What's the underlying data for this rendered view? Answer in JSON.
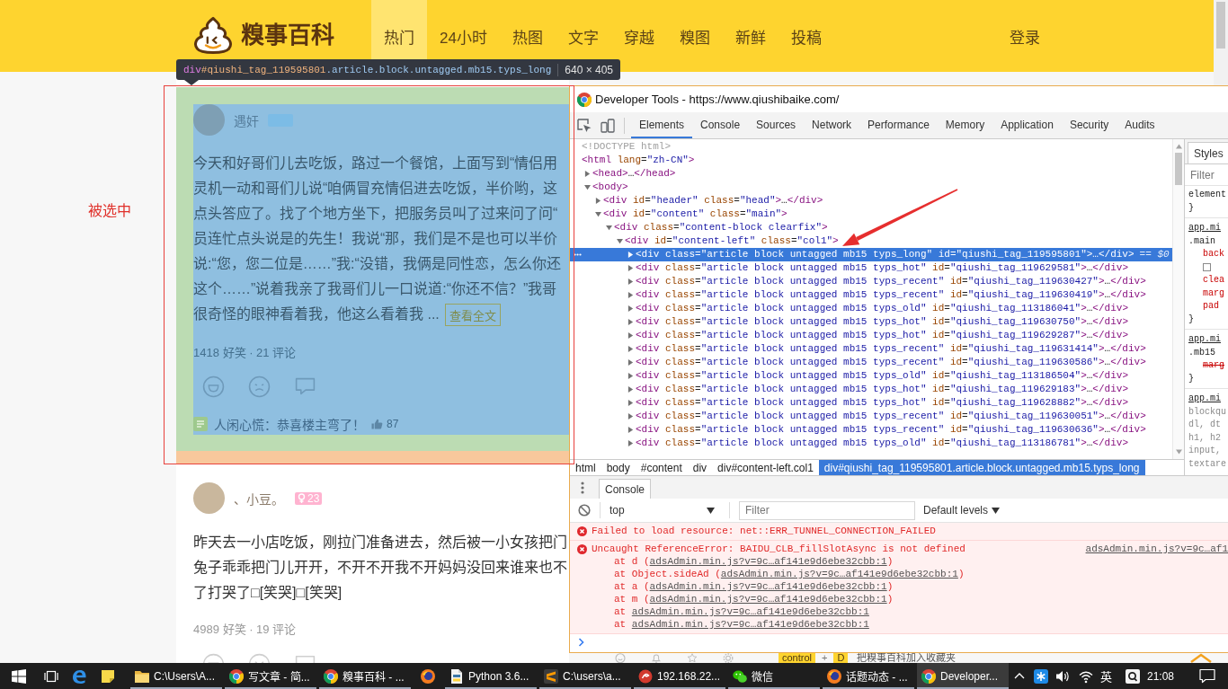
{
  "browser_page": {
    "header": {
      "logo_text": "糗事百科",
      "nav": [
        {
          "label": "热门",
          "selected": true
        },
        {
          "label": "24小时",
          "selected": false
        },
        {
          "label": "热图",
          "selected": false
        },
        {
          "label": "文字",
          "selected": false
        },
        {
          "label": "穿越",
          "selected": false
        },
        {
          "label": "糗图",
          "selected": false
        },
        {
          "label": "新鲜",
          "selected": false
        },
        {
          "label": "投稿",
          "selected": false
        }
      ],
      "login": "登录"
    },
    "inspect_tooltip": {
      "tag": "div",
      "id": "#qiushi_tag_119595801",
      "classes": ".article.block.untagged.mb15.typs_long",
      "size": "640 × 405"
    },
    "side_note": "被选中",
    "articles": [
      {
        "highlighted": true,
        "author": "遇奸",
        "badge": {
          "color": "#7cbce6"
        },
        "lines": [
          "今天和好哥们儿去吃饭，路过一个餐馆，上面写到“情侣用",
          "灵机一动和哥们儿说“咱俩冒充情侣进去吃饭，半价哟，这",
          "点头答应了。找了个地方坐下，把服务员叫了过来问了问“",
          "员连忙点头说是的先生！我说“那，我们是不是也可以半价",
          "说:“您，您二位是……”我:“没错，我俩是同性恋，怎么你还",
          "这个……”说着我亲了我哥们儿一口说道:“你还不信？”我哥",
          "很奇怪的眼神看着我，他这么看着我 ..."
        ],
        "more_link": "查看全文",
        "stats": "1418 好笑 · 21 评论",
        "top_comment": {
          "text": "人闲心慌：恭喜楼主弯了！",
          "likes": "87"
        }
      },
      {
        "highlighted": false,
        "author": "、小豆。",
        "badge": {
          "color": "#ffb3d0",
          "text": "23"
        },
        "lines": [
          "昨天去一小店吃饭，刚拉门准备进去，然后被一小女孩把门",
          "兔子乖乖把门儿开开，不开不开我不开妈妈没回来谁来也不",
          "了打哭了□[笑哭]□[笑哭]"
        ],
        "stats": "4989 好笑 · 19 评论"
      }
    ],
    "bookmark_hint": {
      "keys": [
        "control",
        "D"
      ],
      "joiner": "+",
      "text": "把糗事百科加入收藏夹"
    }
  },
  "devtools": {
    "title": "Developer Tools - https://www.qiushibaike.com/",
    "tabs": [
      {
        "label": "Elements",
        "selected": true
      },
      {
        "label": "Console",
        "selected": false
      },
      {
        "label": "Sources",
        "selected": false
      },
      {
        "label": "Network",
        "selected": false
      },
      {
        "label": "Performance",
        "selected": false
      },
      {
        "label": "Memory",
        "selected": false
      },
      {
        "label": "Application",
        "selected": false
      },
      {
        "label": "Security",
        "selected": false
      },
      {
        "label": "Audits",
        "selected": false
      }
    ],
    "dom_tree": [
      {
        "kind": "doctype",
        "markup": "<!DOCTYPE html>",
        "selected": false
      },
      {
        "kind": "root",
        "markup": "<html lang=\"zh-CN\">",
        "selected": false,
        "children": [
          {
            "kind": "element",
            "markup": "<head>…</head>",
            "expanded": false,
            "selected": false
          },
          {
            "kind": "element",
            "markup": "<body>",
            "expanded": true,
            "selected": false,
            "children": [
              {
                "kind": "element",
                "markup": "<div id=\"header\" class=\"head\">…</div>",
                "expanded": false,
                "selected": false
              },
              {
                "kind": "element",
                "markup": "<div id=\"content\" class=\"main\">",
                "expanded": true,
                "selected": false,
                "children": [
                  {
                    "kind": "element",
                    "markup": "<div class=\"content-block clearfix\">",
                    "expanded": true,
                    "selected": false,
                    "children": [
                      {
                        "kind": "element",
                        "markup": "<div id=\"content-left\" class=\"col1\">",
                        "expanded": true,
                        "selected": false,
                        "children": [
                          {
                            "kind": "element",
                            "markup": "<div class=\"article block untagged mb15 typs_long\" id=\"qiushi_tag_119595801\">…</div>",
                            "expanded": false,
                            "selected": true,
                            "console_ref": "== $0"
                          },
                          {
                            "kind": "element",
                            "markup": "<div class=\"article block untagged mb15 typs_hot\" id=\"qiushi_tag_119629581\">…</div>",
                            "expanded": false,
                            "selected": false
                          },
                          {
                            "kind": "element",
                            "markup": "<div class=\"article block untagged mb15 typs_recent\" id=\"qiushi_tag_119630427\">…</div>",
                            "expanded": false,
                            "selected": false
                          },
                          {
                            "kind": "element",
                            "markup": "<div class=\"article block untagged mb15 typs_recent\" id=\"qiushi_tag_119630419\">…</div>",
                            "expanded": false,
                            "selected": false
                          },
                          {
                            "kind": "element",
                            "markup": "<div class=\"article block untagged mb15 typs_old\" id=\"qiushi_tag_113186041\">…</div>",
                            "expanded": false,
                            "selected": false
                          },
                          {
                            "kind": "element",
                            "markup": "<div class=\"article block untagged mb15 typs_hot\" id=\"qiushi_tag_119630750\">…</div>",
                            "expanded": false,
                            "selected": false
                          },
                          {
                            "kind": "element",
                            "markup": "<div class=\"article block untagged mb15 typs_hot\" id=\"qiushi_tag_119629287\">…</div>",
                            "expanded": false,
                            "selected": false
                          },
                          {
                            "kind": "element",
                            "markup": "<div class=\"article block untagged mb15 typs_recent\" id=\"qiushi_tag_119631414\">…</div>",
                            "expanded": false,
                            "selected": false
                          },
                          {
                            "kind": "element",
                            "markup": "<div class=\"article block untagged mb15 typs_recent\" id=\"qiushi_tag_119630586\">…</div>",
                            "expanded": false,
                            "selected": false
                          },
                          {
                            "kind": "element",
                            "markup": "<div class=\"article block untagged mb15 typs_old\" id=\"qiushi_tag_113186504\">…</div>",
                            "expanded": false,
                            "selected": false
                          },
                          {
                            "kind": "element",
                            "markup": "<div class=\"article block untagged mb15 typs_hot\" id=\"qiushi_tag_119629183\">…</div>",
                            "expanded": false,
                            "selected": false
                          },
                          {
                            "kind": "element",
                            "markup": "<div class=\"article block untagged mb15 typs_hot\" id=\"qiushi_tag_119628882\">…</div>",
                            "expanded": false,
                            "selected": false
                          },
                          {
                            "kind": "element",
                            "markup": "<div class=\"article block untagged mb15 typs_recent\" id=\"qiushi_tag_119630051\">…</div>",
                            "expanded": false,
                            "selected": false
                          },
                          {
                            "kind": "element",
                            "markup": "<div class=\"article block untagged mb15 typs_recent\" id=\"qiushi_tag_119630636\">…</div>",
                            "expanded": false,
                            "selected": false
                          },
                          {
                            "kind": "element",
                            "markup": "<div class=\"article block untagged mb15 typs_old\" id=\"qiushi_tag_113186781\">…</div>",
                            "expanded": false,
                            "selected": false
                          }
                        ]
                      }
                    ]
                  }
                ]
              }
            ]
          }
        ]
      }
    ],
    "breadcrumbs": [
      {
        "label": "html",
        "selected": false
      },
      {
        "label": "body",
        "selected": false
      },
      {
        "label": "#content",
        "selected": false
      },
      {
        "label": "div",
        "selected": false
      },
      {
        "label": "div#content-left.col1",
        "selected": false
      },
      {
        "label": "div#qiushi_tag_119595801.article.block.untagged.mb15.typs_long",
        "selected": true
      }
    ],
    "styles": {
      "tab": "Styles",
      "filter_placeholder": "Filter",
      "lines": [
        {
          "kind": "selector",
          "text": "element"
        },
        {
          "kind": "brace",
          "text": "}"
        },
        {
          "kind": "source",
          "text": "app.mi"
        },
        {
          "kind": "selector",
          "text": ".main"
        },
        {
          "kind": "property",
          "text": "back",
          "struck": false
        },
        {
          "kind": "swatch"
        },
        {
          "kind": "property",
          "text": "clea",
          "struck": false
        },
        {
          "kind": "property",
          "text": "marg",
          "struck": false
        },
        {
          "kind": "property",
          "text": "pad",
          "struck": false
        },
        {
          "kind": "brace",
          "text": "}"
        },
        {
          "kind": "source",
          "text": "app.mi"
        },
        {
          "kind": "selector",
          "text": ".mb15"
        },
        {
          "kind": "property",
          "text": "marg",
          "struck": true
        },
        {
          "kind": "brace",
          "text": "}"
        },
        {
          "kind": "source",
          "text": "app.mi"
        },
        {
          "kind": "dim-selector",
          "text": "blockqu"
        },
        {
          "kind": "dim-selector",
          "text": "dl, dt"
        },
        {
          "kind": "dim-selector",
          "text": "h1, h2"
        },
        {
          "kind": "dim-selector",
          "text": "input,"
        },
        {
          "kind": "dim-selector",
          "text": "textare"
        }
      ]
    },
    "console": {
      "tab": "Console",
      "context": "top",
      "filter_placeholder": "Filter",
      "levels": "Default levels",
      "messages": [
        {
          "kind": "error",
          "text": "Failed to load resource: net::ERR_TUNNEL_CONNECTION_FAILED"
        },
        {
          "kind": "error",
          "text": "Uncaught ReferenceError: BAIDU_CLB_fillSlotAsync is not defined",
          "source": "adsAdmin.min.js?v=9c…af1",
          "stack": [
            {
              "prefix": "at d (",
              "link": "adsAdmin.min.js?v=9c…af141e9d6ebe32cbb:1",
              "suffix": ")"
            },
            {
              "prefix": "at Object.sideAd (",
              "link": "adsAdmin.min.js?v=9c…af141e9d6ebe32cbb:1",
              "suffix": ")"
            },
            {
              "prefix": "at a (",
              "link": "adsAdmin.min.js?v=9c…af141e9d6ebe32cbb:1",
              "suffix": ")"
            },
            {
              "prefix": "at m (",
              "link": "adsAdmin.min.js?v=9c…af141e9d6ebe32cbb:1",
              "suffix": ")"
            },
            {
              "prefix": "at ",
              "link": "adsAdmin.min.js?v=9c…af141e9d6ebe32cbb:1"
            },
            {
              "prefix": "at ",
              "link": "adsAdmin.min.js?v=9c…af141e9d6ebe32cbb:1"
            }
          ]
        }
      ]
    }
  },
  "taskbar": {
    "apps": [
      {
        "kind": "folder",
        "label": "C:\\Users\\A...",
        "running": true,
        "selected": false
      },
      {
        "kind": "chrome",
        "label": "写文章 - 简...",
        "running": true,
        "selected": false
      },
      {
        "kind": "chrome",
        "label": "糗事百科 - ...",
        "running": true,
        "selected": false
      },
      {
        "kind": "firefox",
        "running": false,
        "selected": false
      },
      {
        "kind": "python",
        "label": "Python 3.6...",
        "running": true,
        "selected": false
      },
      {
        "kind": "sublime",
        "label": "C:\\users\\a...",
        "running": true,
        "selected": false
      },
      {
        "kind": "terminal",
        "label": "192.168.22...",
        "running": true,
        "selected": false
      },
      {
        "kind": "wechat",
        "label": "微信",
        "running": true,
        "selected": false
      },
      {
        "kind": "firefox",
        "label": "话题动态 - ...",
        "running": true,
        "selected": false
      },
      {
        "kind": "chrome",
        "label": "Developer...",
        "running": true,
        "selected": true
      }
    ],
    "input_method": "英",
    "clock": "21:08"
  }
}
